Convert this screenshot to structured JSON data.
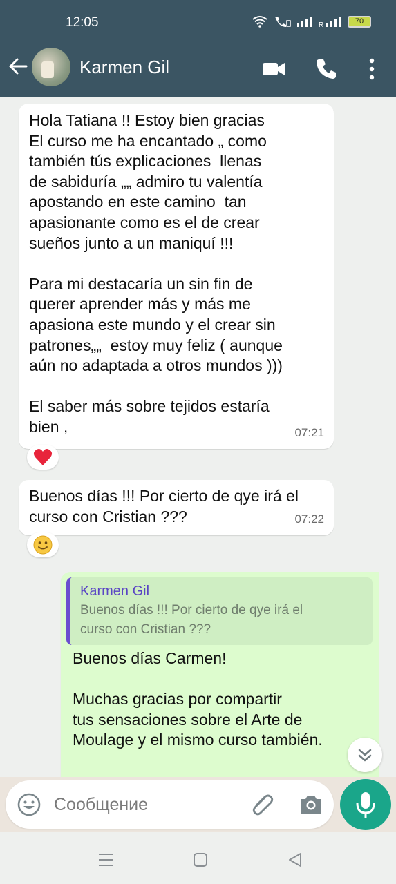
{
  "status_bar": {
    "time": "12:05",
    "battery": "70",
    "icons": [
      "wifi-icon",
      "volte-call-icon",
      "signal-icon",
      "roaming-signal-icon",
      "battery-icon"
    ]
  },
  "header": {
    "contact_name": "Karmen Gil",
    "icons": [
      "back-arrow-icon",
      "video-call-icon",
      "voice-call-icon",
      "more-options-icon"
    ]
  },
  "messages": [
    {
      "direction": "incoming",
      "text": "Hola Tatiana !! Estoy bien gracias\nEl curso me ha encantado „ como\ntambién tús explicaciones  llenas\nde sabiduría „„ admiro tu valentía\napostando en este camino  tan\napasionante como es el de crear\nsueños junto a un maniquí !!!\n\nPara mi destacaría un sin fin de\nquerer aprender más y más me\napasiona este mundo y el crear sin\npatrones„„  estoy muy feliz ( aunque\naún no adaptada a otros mundos )))\n\nEl saber más sobre tejidos estaría\nbien ,",
      "time": "07:21",
      "reaction": "❤️"
    },
    {
      "direction": "incoming",
      "text": "Buenos días !!! Por cierto de qye irá el\ncurso con Cristian ???",
      "time": "07:22",
      "reaction": "🙂"
    },
    {
      "direction": "outgoing",
      "quote_author": "Karmen Gil",
      "quote_text": "Buenos días !!! Por cierto de qye irá el\ncurso con Cristian ???",
      "text": "Buenos días Carmen!\n\nMuchas gracias por compartir\ntus sensaciones sobre el Arte de\nMoulage y el mismo curso también."
    }
  ],
  "composer": {
    "placeholder": "Сообщение",
    "icons": [
      "emoji-icon",
      "attach-icon",
      "camera-icon",
      "mic-icon"
    ]
  },
  "colors": {
    "header_bg": "#3b5563",
    "outgoing_bubble": "#ddfcce",
    "accent_green": "#1aa68a",
    "quote_bar": "#6b4fcf"
  }
}
